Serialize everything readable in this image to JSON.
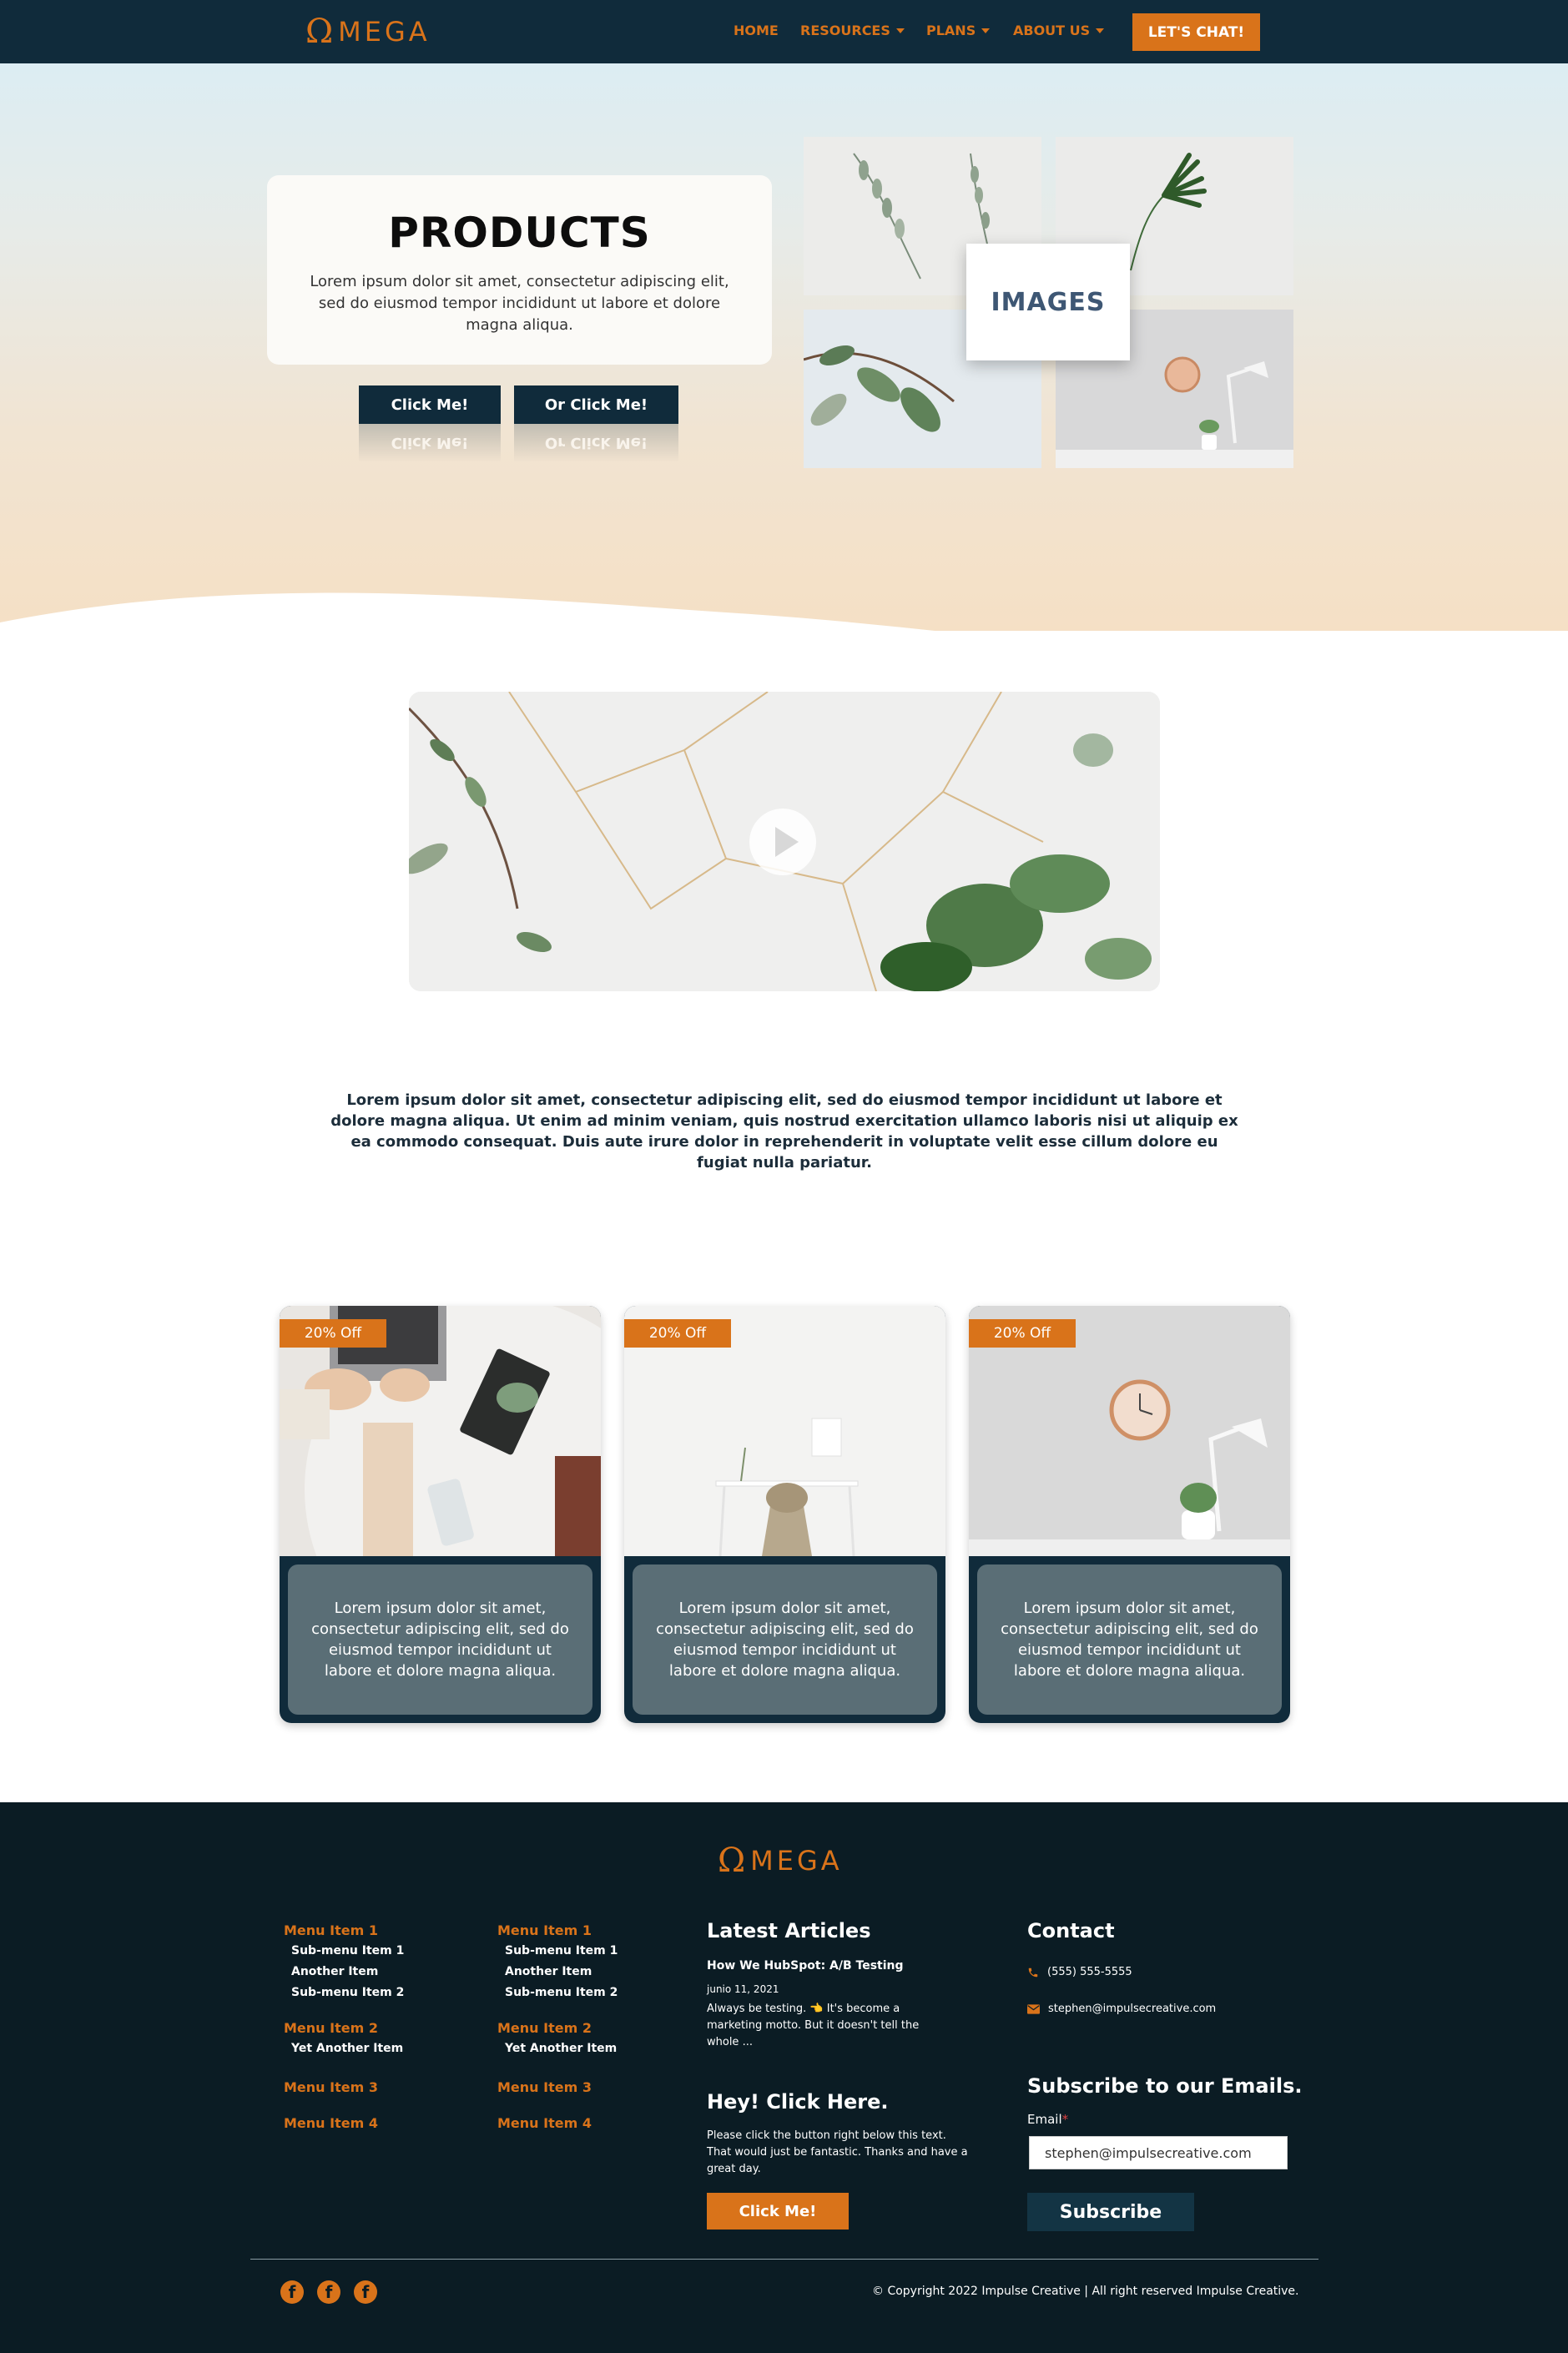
{
  "nav": {
    "logo_symbol": "Ω",
    "logo_text": "MEGA",
    "items": [
      {
        "label": "HOME",
        "dropdown": false
      },
      {
        "label": "RESOURCES",
        "dropdown": true
      },
      {
        "label": "PLANS",
        "dropdown": true
      },
      {
        "label": "ABOUT US",
        "dropdown": true
      }
    ],
    "cta_label": "LET'S CHAT!"
  },
  "hero": {
    "title": "PRODUCTS",
    "text": "Lorem ipsum dolor sit amet, consectetur adipiscing elit, sed do eiusmod tempor incididunt ut labore et dolore magna aliqua.",
    "button1": "Click Me!",
    "button2": "Or Click Me!",
    "images_label": "IMAGES"
  },
  "video": {
    "play_icon": "play-icon"
  },
  "intro_text": "Lorem ipsum dolor sit amet, consectetur adipiscing elit, sed do eiusmod tempor incididunt ut labore et dolore magna aliqua. Ut enim ad minim veniam, quis nostrud exercitation ullamco laboris nisi ut aliquip ex ea commodo consequat. Duis aute irure dolor in reprehenderit in voluptate velit esse cillum dolore eu fugiat nulla pariatur.",
  "cards": [
    {
      "badge": "20% Off",
      "text": "Lorem ipsum dolor sit amet, consectetur adipiscing elit, sed do eiusmod tempor incididunt ut labore et dolore magna aliqua."
    },
    {
      "badge": "20% Off",
      "text": "Lorem ipsum dolor sit amet, consectetur adipiscing elit, sed do eiusmod tempor incididunt ut labore et dolore magna aliqua."
    },
    {
      "badge": "20% Off",
      "text": "Lorem ipsum dolor sit amet, consectetur adipiscing elit, sed do eiusmod tempor incididunt ut labore et dolore magna aliqua."
    }
  ],
  "footer": {
    "logo_symbol": "Ω",
    "logo_text": "MEGA",
    "menu": {
      "item1": "Menu Item 1",
      "sub1a": "Sub-menu Item 1",
      "sub1b": "Another Item",
      "sub1c": "Sub-menu Item 2",
      "item2": "Menu Item 2",
      "sub2a": "Yet Another Item",
      "item3": "Menu Item 3",
      "item4": "Menu Item 4"
    },
    "articles": {
      "heading": "Latest Articles",
      "title": "How We HubSpot: A/B Testing",
      "date": "junio 11, 2021",
      "excerpt": "Always be testing. 👈 It's become a marketing motto. But it doesn't tell the whole ..."
    },
    "hey": {
      "heading": "Hey! Click Here.",
      "text": "Please click the button right below this text. That would just be fantastic. Thanks and have a great day.",
      "button": "Click Me!"
    },
    "contact": {
      "heading": "Contact",
      "phone": "(555) 555-5555",
      "email": "stephen@impulsecreative.com"
    },
    "subscribe": {
      "heading": "Subscribe to our Emails.",
      "label": "Email",
      "required_mark": "*",
      "value": "stephen@impulsecreative.com",
      "button": "Subscribe"
    },
    "social_icons": [
      "facebook-icon",
      "facebook-icon",
      "facebook-icon"
    ],
    "copyright": "© Copyright 2022 Impulse Creative | All right reserved Impulse Creative."
  },
  "colors": {
    "navy": "#102b3b",
    "orange": "#d9731a",
    "footer_bg": "#0b1c24",
    "card_body": "#5a6e76"
  }
}
